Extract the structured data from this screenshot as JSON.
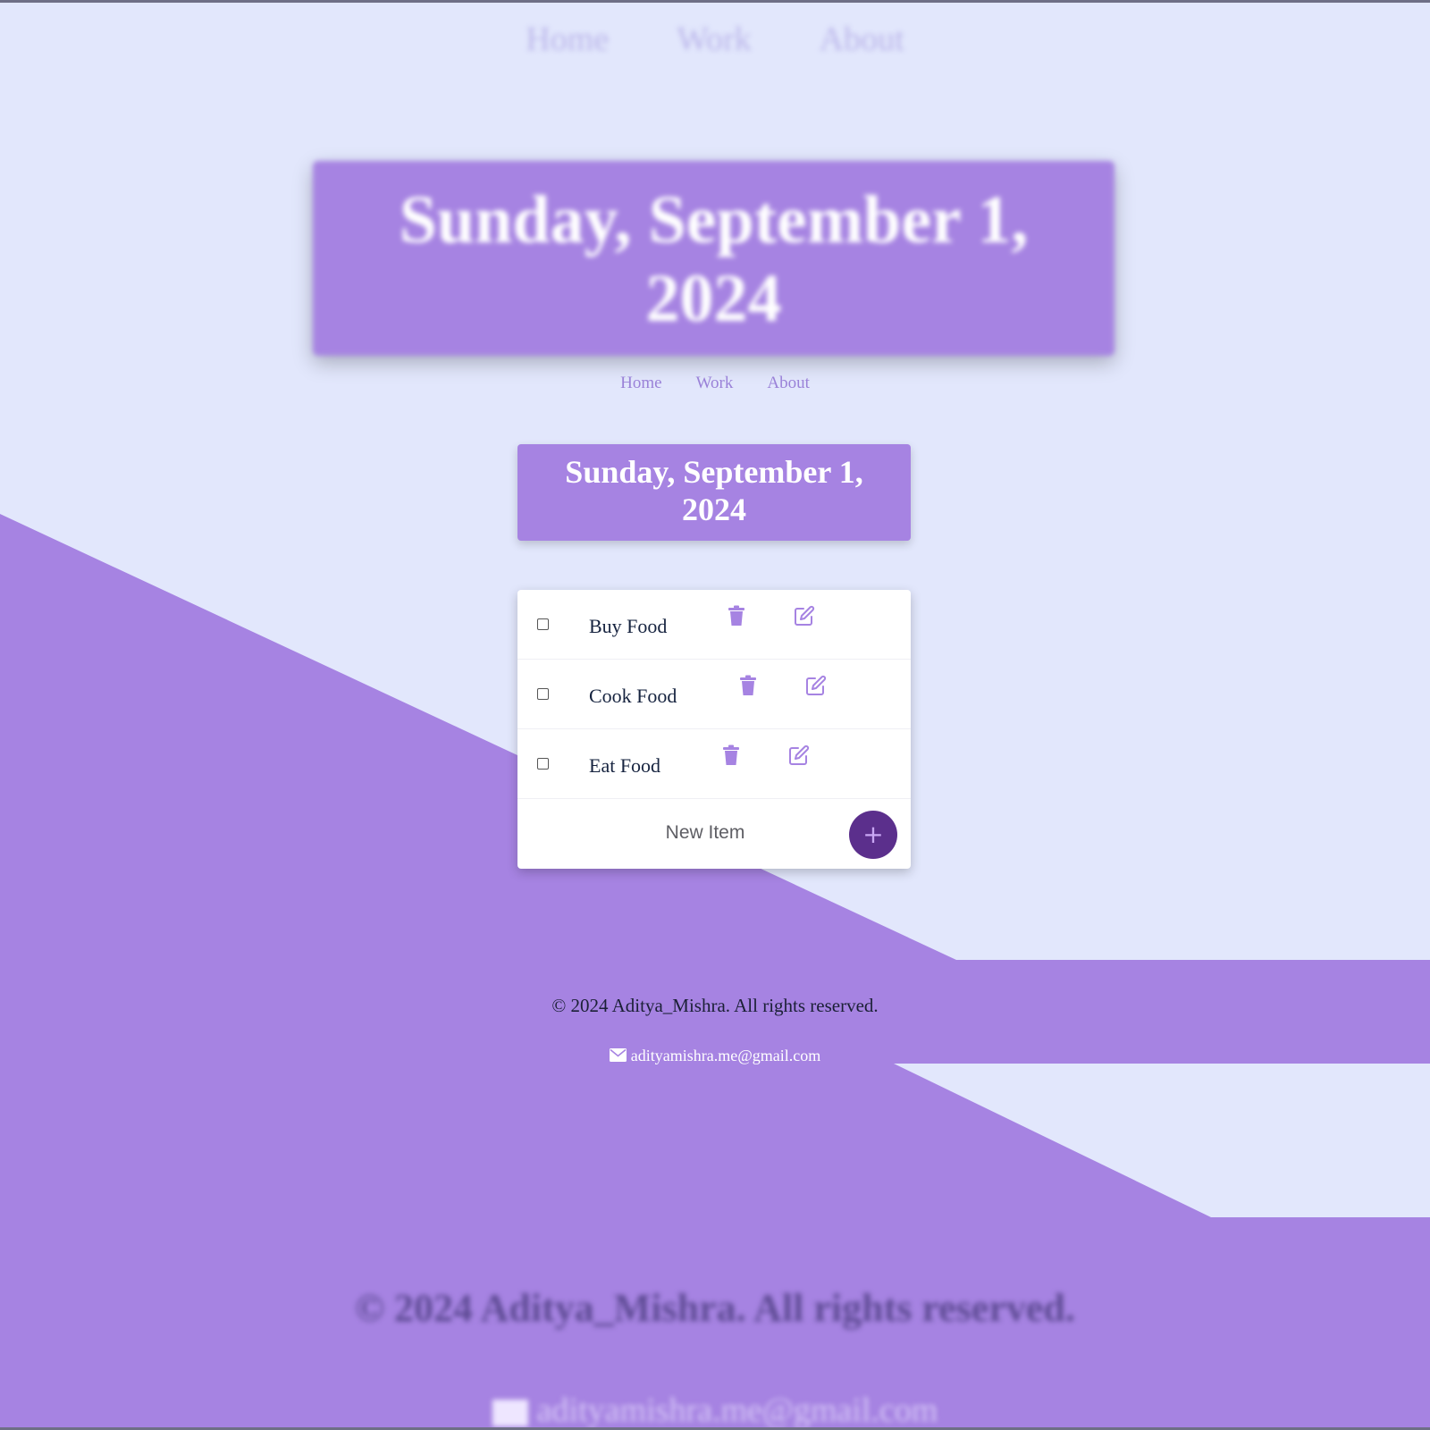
{
  "nav": {
    "items": [
      "Home",
      "Work",
      "About"
    ]
  },
  "header": {
    "date_title": "Sunday, September 1, 2024"
  },
  "todo": {
    "items": [
      {
        "label": "Buy Food",
        "checked": false
      },
      {
        "label": "Cook Food",
        "checked": false
      },
      {
        "label": "Eat Food",
        "checked": false
      }
    ],
    "new_item_placeholder": "New Item",
    "add_button_label": "+"
  },
  "footer": {
    "copyright": "© 2024 Aditya_Mishra. All rights reserved.",
    "email": "adityamishra.me@gmail.com"
  },
  "colors": {
    "background": "#e2e7fc",
    "accent_purple": "#a683e2",
    "add_button": "#5b2f8c",
    "text_dark": "#16233f"
  },
  "icons": [
    "trash-icon",
    "edit-icon",
    "plus-icon",
    "envelope-icon"
  ]
}
